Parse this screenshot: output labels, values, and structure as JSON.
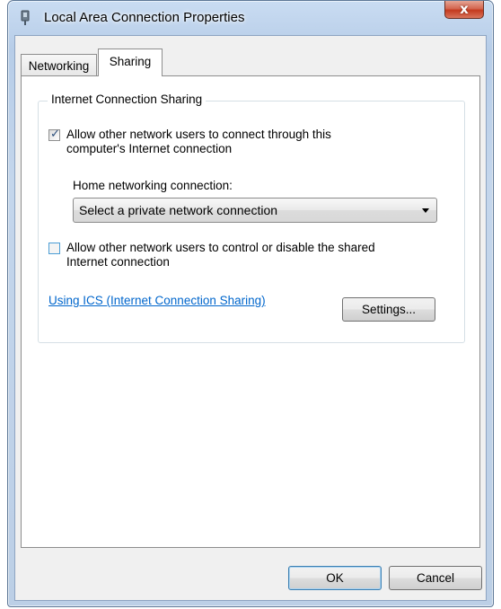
{
  "window": {
    "title": "Local Area Connection Properties",
    "close_glyph": "x",
    "icon": "network-adapter-icon"
  },
  "tabs": [
    {
      "label": "Networking",
      "selected": false
    },
    {
      "label": "Sharing",
      "selected": true
    }
  ],
  "sharing": {
    "group_title": "Internet Connection Sharing",
    "allow_connect": {
      "checked": true,
      "label": "Allow other network users to connect through this computer's Internet connection"
    },
    "home_networking_label": "Home networking connection:",
    "home_networking_select": {
      "value": "Select a private network connection"
    },
    "allow_control": {
      "checked": false,
      "label": "Allow other network users to control or disable the shared Internet connection"
    },
    "ics_link": "Using ICS (Internet Connection Sharing)",
    "settings_button": "Settings..."
  },
  "footer": {
    "ok_label": "OK",
    "cancel_label": "Cancel"
  },
  "colors": {
    "link": "#0066cc",
    "close_button": "#c43a1e"
  }
}
